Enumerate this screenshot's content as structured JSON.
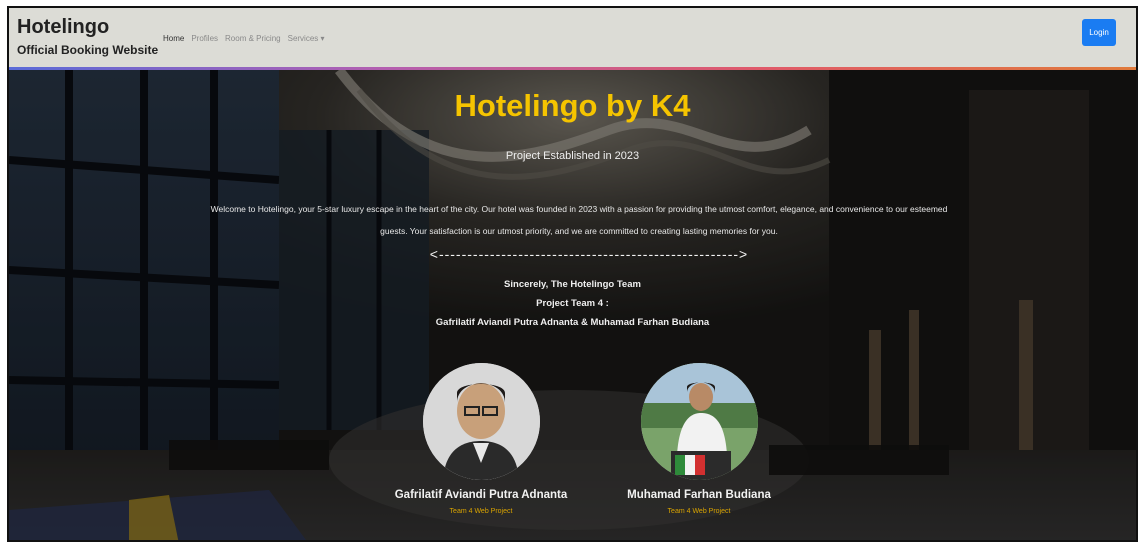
{
  "navbar": {
    "brand_title": "Hotelingo",
    "brand_subtitle": "Official Booking Website",
    "links": [
      "Home",
      "Profiles",
      "Room & Pricing",
      "Services ▾"
    ],
    "login_label": "Login"
  },
  "hero": {
    "title": "Hotelingo by K4",
    "subtitle": "Project Established in 2023",
    "welcome": "Welcome to Hotelingo, your 5-star luxury escape in the heart of the city. Our hotel was founded in 2023 with a passion for providing the utmost comfort, elegance, and convenience to our esteemed guests. Your satisfaction is our utmost priority, and we are committed to creating lasting memories for you.",
    "divider": "<----------------------------------------------------->",
    "signoff_line1": "Sincerely, The Hotelingo Team",
    "signoff_line2": "Project Team 4 :",
    "signoff_line3": "Gafrilatif Aviandi Putra Adnanta & Muhamad Farhan Budiana"
  },
  "members": [
    {
      "name": "Gafrilatif Aviandi Putra Adnanta",
      "role": "Team 4 Web Project"
    },
    {
      "name": "Muhamad Farhan Budiana",
      "role": "Team 4 Web Project"
    }
  ],
  "colors": {
    "accent": "#f5c400",
    "button": "#1a7cf2",
    "navbar": "#dcdcd6"
  }
}
